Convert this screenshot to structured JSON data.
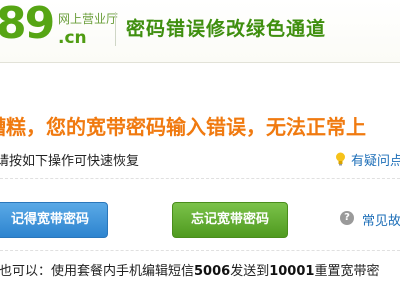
{
  "header": {
    "logo_number": "89",
    "logo_brand": "网上营业厅",
    "logo_domain": ".cn",
    "title": "密码错误修改绿色通道"
  },
  "main": {
    "error_message": "糟糕，您的宽带密码输入错误，无法正常上",
    "hint": "请按如下操作可快速恢复",
    "help_link": "有疑问点"
  },
  "buttons": {
    "remember_label": "记得宽带密码",
    "forget_label": "忘记宽带密码"
  },
  "faq": {
    "icon_glyph": "?",
    "label": "常见故"
  },
  "sms": {
    "prefix": "您也可以：使用套餐内手机编辑短信",
    "code": "5006",
    "middle": "发送到",
    "number": "10001",
    "suffix": "重置宽带密"
  },
  "colors": {
    "brand_green": "#56a514",
    "error_orange": "#f07a10",
    "link_blue": "#1e6fb8",
    "button_blue": "#2d84cf",
    "button_green": "#4f9a1f"
  }
}
